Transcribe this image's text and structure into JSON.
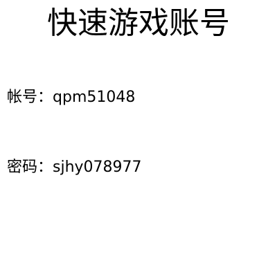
{
  "title": "快速游戏账号",
  "account": {
    "label": "帐号：",
    "value": "qpm51048"
  },
  "password": {
    "label": "密码：",
    "value": "sjhy078977"
  },
  "colors": {
    "background": "#ffffff",
    "text": "#000000"
  }
}
